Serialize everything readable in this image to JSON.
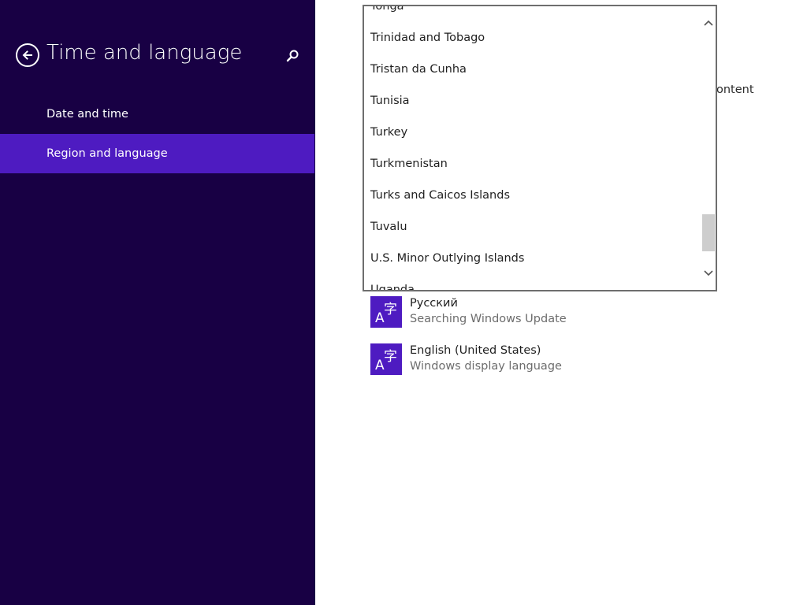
{
  "nav": {
    "title": "Time and language",
    "items": [
      {
        "label": "Date and time",
        "selected": false
      },
      {
        "label": "Region and language",
        "selected": true
      }
    ]
  },
  "content": {
    "partial_text": "ontent",
    "languages": [
      {
        "name": "Русский",
        "status": "Searching Windows Update",
        "icon": "language-icon"
      },
      {
        "name": "English (United States)",
        "status": "Windows display language",
        "icon": "language-icon"
      }
    ]
  },
  "dropdown": {
    "options": [
      "Tonga",
      "Trinidad and Tobago",
      "Tristan da Cunha",
      "Tunisia",
      "Turkey",
      "Turkmenistan",
      "Turks and Caicos Islands",
      "Tuvalu",
      "U.S. Minor Outlying Islands",
      "Uganda"
    ]
  },
  "icons": {
    "back": "back-arrow-icon",
    "search": "search-icon",
    "scroll_up": "chevron-up-icon",
    "scroll_down": "chevron-down-icon"
  },
  "colors": {
    "nav_background": "#180044",
    "accent": "#4e1bc1"
  }
}
